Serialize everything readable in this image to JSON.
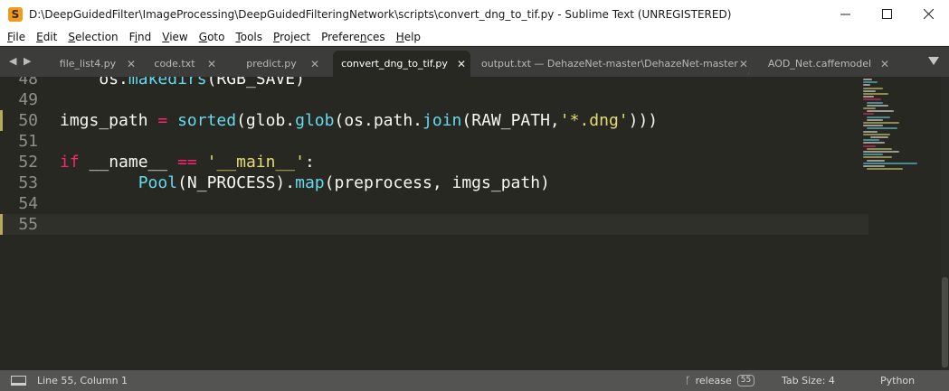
{
  "window": {
    "title": "D:\\DeepGuidedFilter\\ImageProcessing\\DeepGuidedFilteringNetwork\\scripts\\convert_dng_to_tif.py - Sublime Text (UNREGISTERED)",
    "app_icon_letter": "S",
    "minimize": "—",
    "maximize": "☐",
    "close": "✕"
  },
  "menu": [
    {
      "label": "File",
      "u": "F",
      "rest": "ile"
    },
    {
      "label": "Edit",
      "u": "E",
      "rest": "dit"
    },
    {
      "label": "Selection",
      "u": "S",
      "rest": "election"
    },
    {
      "label": "Find",
      "pre": "F",
      "u": "i",
      "rest": "nd"
    },
    {
      "label": "View",
      "u": "V",
      "rest": "iew"
    },
    {
      "label": "Goto",
      "u": "G",
      "rest": "oto"
    },
    {
      "label": "Tools",
      "u": "T",
      "rest": "ools"
    },
    {
      "label": "Project",
      "u": "P",
      "rest": "roject"
    },
    {
      "label": "Preferences",
      "pre": "Prefere",
      "u": "n",
      "rest": "ces"
    },
    {
      "label": "Help",
      "u": "H",
      "rest": "elp"
    }
  ],
  "tabs": {
    "nav": "◀ ▶",
    "items": [
      {
        "label": "file_list4.py",
        "close": "✕",
        "active": false
      },
      {
        "label": "code.txt",
        "close": "✕",
        "active": false
      },
      {
        "label": "predict.py",
        "close": "✕",
        "active": false
      },
      {
        "label": "convert_dng_to_tif.py",
        "close": "✕",
        "active": true
      },
      {
        "label": "output.txt — DehazeNet-master\\DehazeNet-master",
        "close": "✕",
        "active": false
      },
      {
        "label": "AOD_Net.caffemodel",
        "close": "✕",
        "active": false
      }
    ]
  },
  "editor": {
    "lines": [
      {
        "no": "48",
        "modified": false,
        "tokens": [
          [
            "    ",
            "p"
          ],
          [
            "os",
            "p"
          ],
          [
            ".",
            "p"
          ],
          [
            "makedirs",
            "f"
          ],
          [
            "(RGB_SAVE)",
            "p"
          ]
        ]
      },
      {
        "no": "49",
        "modified": false,
        "tokens": []
      },
      {
        "no": "50",
        "modified": true,
        "tokens": [
          [
            "imgs_path ",
            "p"
          ],
          [
            "=",
            "k"
          ],
          [
            " ",
            "p"
          ],
          [
            "sorted",
            "f"
          ],
          [
            "(glob.",
            "p"
          ],
          [
            "glob",
            "f"
          ],
          [
            "(os.path.",
            "p"
          ],
          [
            "join",
            "f"
          ],
          [
            "(RAW_PATH,",
            "p"
          ],
          [
            "'*.dng'",
            "s"
          ],
          [
            ")))",
            "p"
          ]
        ]
      },
      {
        "no": "51",
        "modified": false,
        "tokens": []
      },
      {
        "no": "52",
        "modified": false,
        "tokens": [
          [
            "if",
            "k"
          ],
          [
            " __name__ ",
            "p"
          ],
          [
            "==",
            "k"
          ],
          [
            " ",
            "p"
          ],
          [
            "'__main__'",
            "s"
          ],
          [
            ":",
            "p"
          ]
        ]
      },
      {
        "no": "53",
        "modified": false,
        "tokens": [
          [
            "        ",
            "p"
          ],
          [
            "Pool",
            "f"
          ],
          [
            "(N_PROCESS).",
            "p"
          ],
          [
            "map",
            "f"
          ],
          [
            "(preprocess, imgs_path)",
            "p"
          ]
        ]
      },
      {
        "no": "54",
        "modified": false,
        "tokens": []
      },
      {
        "no": "55",
        "modified": true,
        "current": true,
        "tokens": []
      }
    ],
    "colors": {
      "p": "#f8f8f2",
      "k": "#f92672",
      "f": "#66d9ef",
      "s": "#e6db74"
    }
  },
  "status": {
    "position": "Line 55, Column 1",
    "branch_icon": "ᚴ",
    "branch": "release",
    "branch_badge": "55",
    "tab_size": "Tab Size: 4",
    "syntax": "Python"
  }
}
